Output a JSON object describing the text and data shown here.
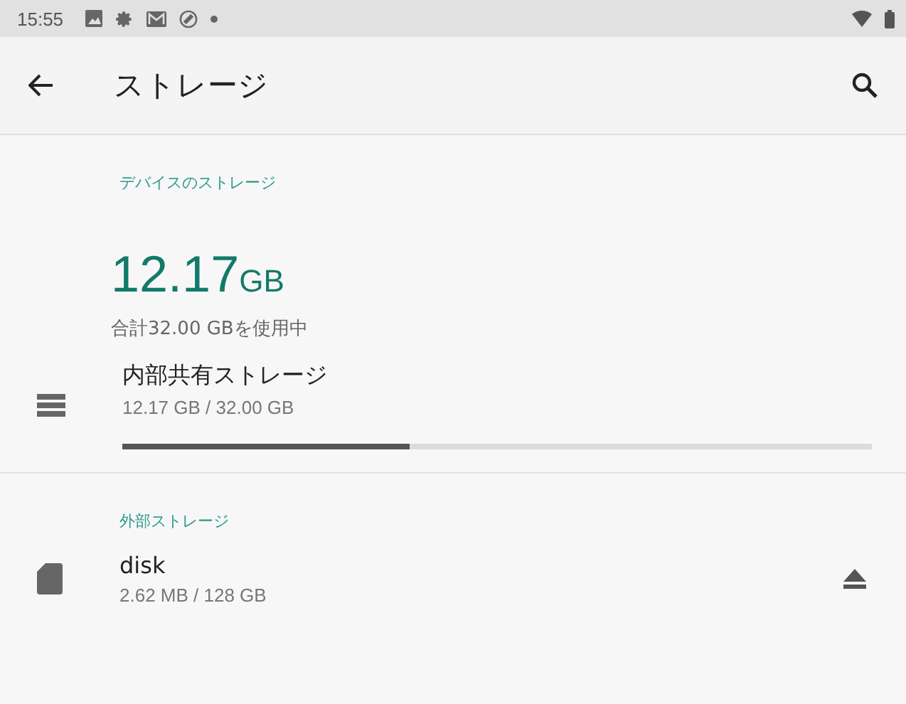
{
  "status_bar": {
    "time": "15:55"
  },
  "app_bar": {
    "title": "ストレージ"
  },
  "sections": [
    {
      "header": "デバイスのストレージ",
      "summary": {
        "amount": "12.17",
        "unit": "GB",
        "caption": "合計32.00 GBを使用中"
      },
      "items": [
        {
          "kind": "internal",
          "title": "内部共有ストレージ",
          "subtitle": "12.17 GB / 32.00 GB",
          "level": 0.383
        }
      ]
    },
    {
      "header": "外部ストレージ",
      "items": [
        {
          "kind": "sdcard",
          "title": "disk",
          "subtitle": "2.62 MB / 128 GB"
        }
      ]
    }
  ]
}
